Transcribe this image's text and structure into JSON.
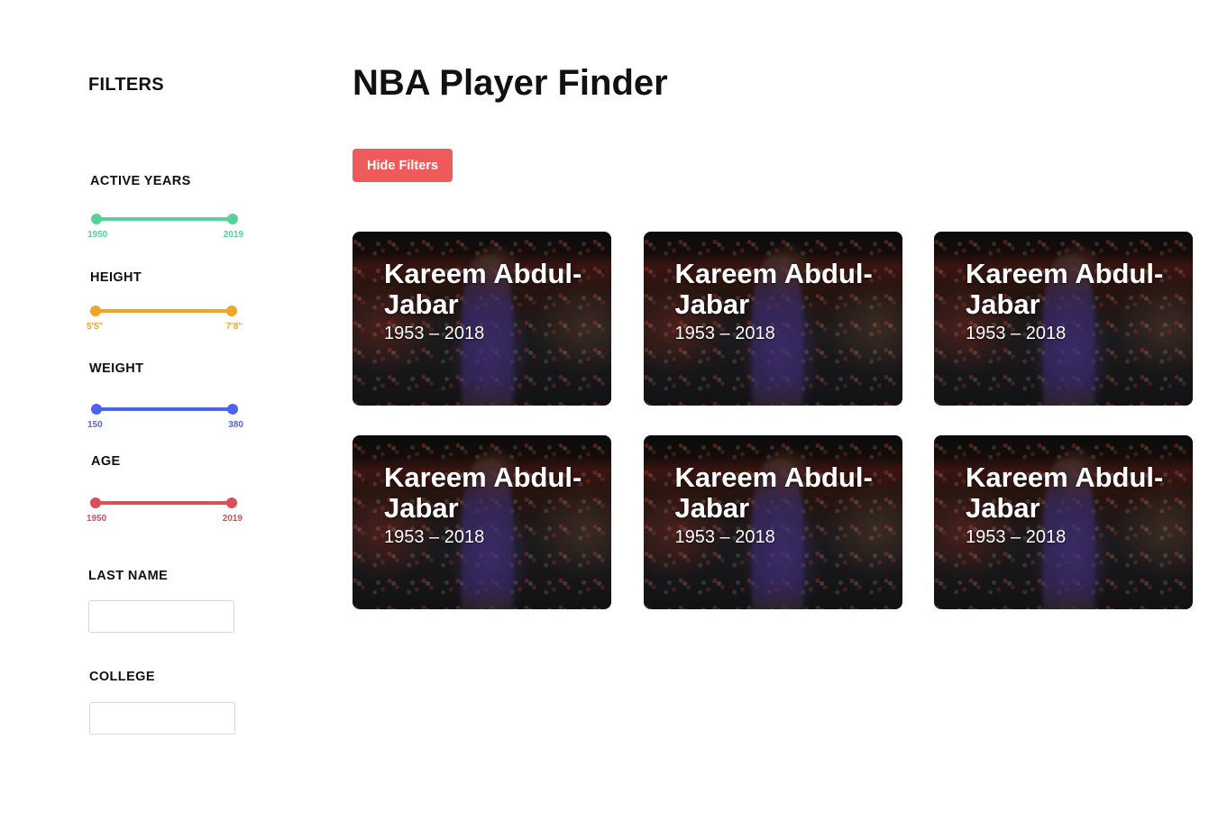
{
  "sidebar": {
    "title": "FILTERS",
    "sliders": [
      {
        "label": "ACTIVE YEARS",
        "min_label": "1950",
        "max_label": "2019",
        "color": "#56d39a",
        "range_fraction": [
          0,
          1
        ]
      },
      {
        "label": "HEIGHT",
        "min_label": "5'5\"",
        "max_label": "7'8\"",
        "color": "#f0a42a",
        "range_fraction": [
          0,
          1
        ]
      },
      {
        "label": "WEIGHT",
        "min_label": "150",
        "max_label": "380",
        "color": "#4d63ec",
        "range_fraction": [
          0,
          1
        ]
      },
      {
        "label": "AGE",
        "min_label": "1950",
        "max_label": "2019",
        "color": "#d9505a",
        "range_fraction": [
          0,
          1
        ]
      }
    ],
    "last_name": {
      "label": "LAST NAME",
      "value": "",
      "placeholder": ""
    },
    "college": {
      "label": "COLLEGE",
      "value": "",
      "placeholder": ""
    }
  },
  "main": {
    "title": "NBA Player Finder",
    "hide_filters_label": "Hide Filters",
    "hide_filters_color": "#ef5a5a",
    "cards": [
      {
        "name": "Kareem Abdul-Jabar",
        "years": "1953 – 2018"
      },
      {
        "name": "Kareem Abdul-Jabar",
        "years": "1953 – 2018"
      },
      {
        "name": "Kareem Abdul-Jabar",
        "years": "1953 – 2018"
      },
      {
        "name": "Kareem Abdul-Jabar",
        "years": "1953 – 2018"
      },
      {
        "name": "Kareem Abdul-Jabar",
        "years": "1953 – 2018"
      },
      {
        "name": "Kareem Abdul-Jabar",
        "years": "1953 – 2018"
      }
    ]
  }
}
